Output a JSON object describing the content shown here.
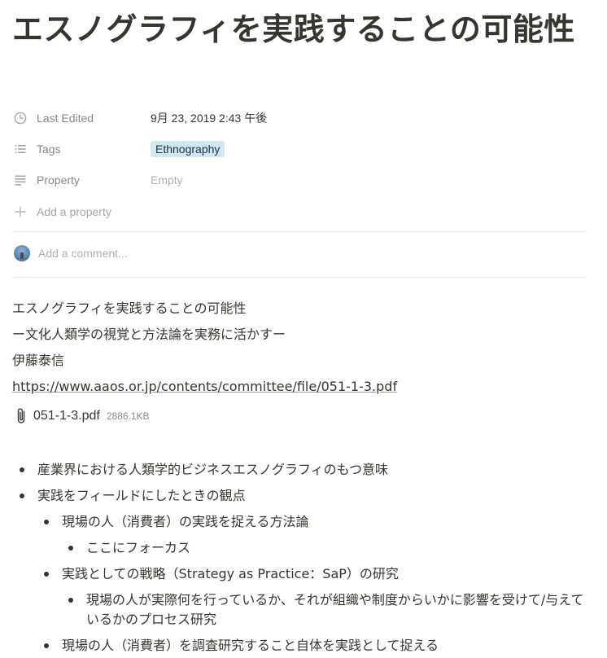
{
  "page": {
    "title": "エスノグラフィを実践することの可能性"
  },
  "properties": {
    "last_edited": {
      "label": "Last Edited",
      "value": "9月 23, 2019 2:43 午後",
      "icon": "clock-icon"
    },
    "tags": {
      "label": "Tags",
      "value": "Ethnography",
      "icon": "list-icon",
      "tag_color": "#d3e5ef"
    },
    "property": {
      "label": "Property",
      "value": "Empty",
      "icon": "text-lines-icon"
    },
    "add_property": {
      "label": "Add a property",
      "icon": "plus-icon"
    }
  },
  "comment": {
    "placeholder": "Add a comment..."
  },
  "body": {
    "line1": "エスノグラフィを実践することの可能性",
    "line2": "ー文化人類学の視覚と方法論を実務に活かすー",
    "line3": "伊藤泰信",
    "link": "https://www.aaos.or.jp/contents/committee/file/051-1-3.pdf"
  },
  "file": {
    "name": "051-1-3.pdf",
    "size": "2886.1KB",
    "icon": "paperclip-icon"
  },
  "bullets": {
    "b1": "産業界における人類学的ビジネスエスノグラフィのもつ意味",
    "b2": "実践をフィールドにしたときの観点",
    "b2_1": "現場の人（消費者）の実践を捉える方法論",
    "b2_1_1": "ここにフォーカス",
    "b2_2": "実践としての戦略（Strategy as Practice：SaP）の研究",
    "b2_2_1": "現場の人が実際何を行っているか、それが組織や制度からいかに影響を受けて/与えているかのプロセス研究",
    "b2_3": "現場の人（消費者）を調査研究すること自体を実践として捉える"
  }
}
